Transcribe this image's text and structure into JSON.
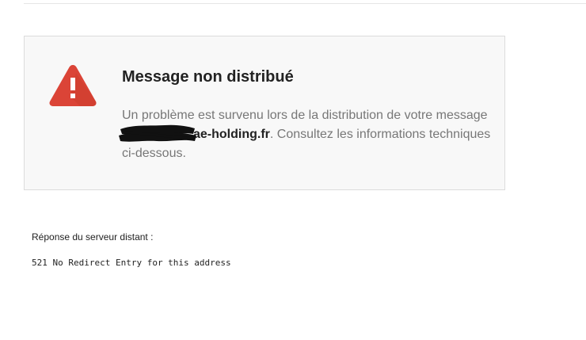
{
  "bounce": {
    "icon": "warning-triangle-icon",
    "icon_color": "#db4437",
    "title": "Message non distribué",
    "message_before": "Un problème est survenu lors de la distribution de votre message ",
    "recipient_domain": "ae-holding.fr",
    "message_after": ". Consultez les informations techniques ci-dessous."
  },
  "remote_server": {
    "label": "Réponse du serveur distant :",
    "response": "521 No Redirect Entry for this address"
  }
}
